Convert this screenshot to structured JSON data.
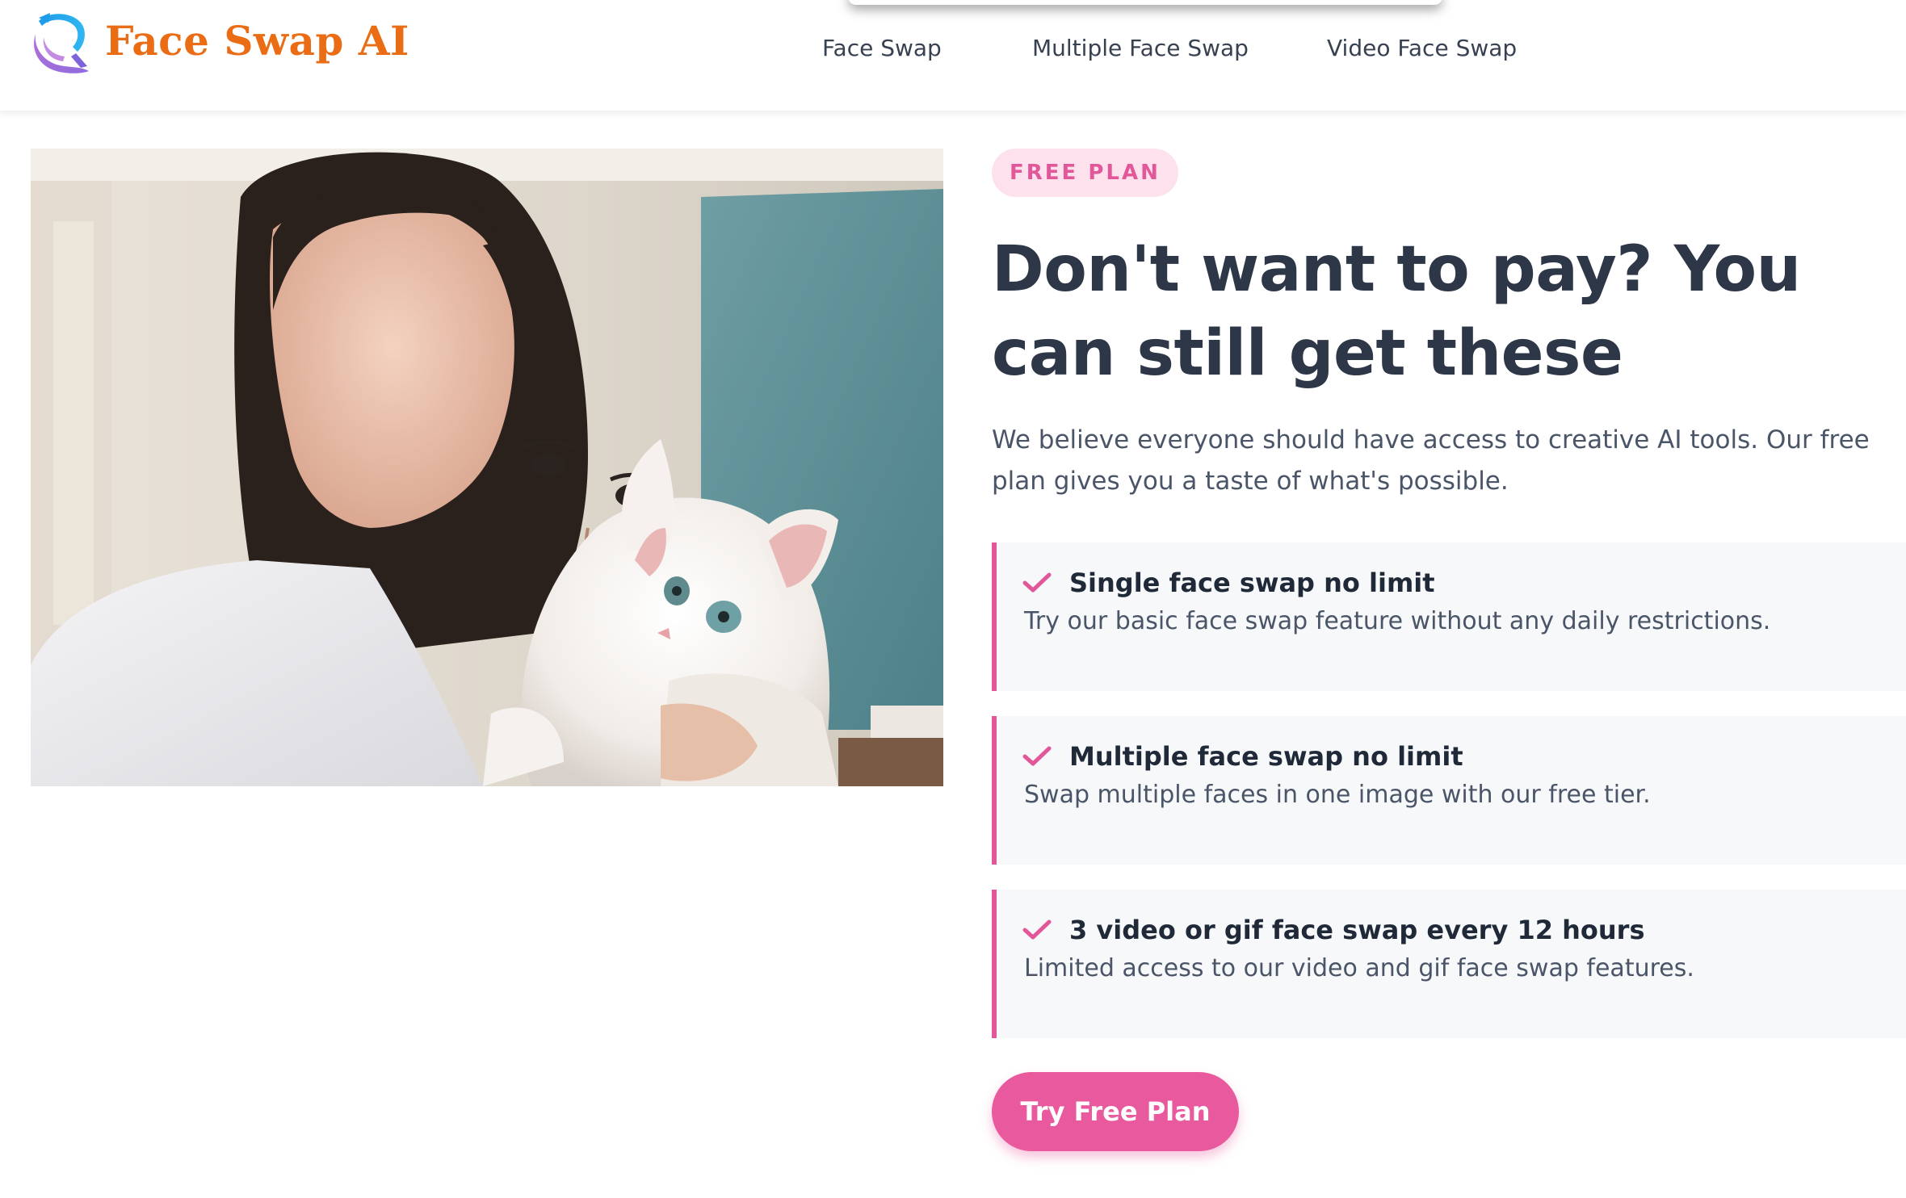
{
  "header": {
    "brand_name": "Face Swap AI",
    "brand_color": "#ea6d16",
    "logo_icon": "swirl-logo-icon",
    "nav": [
      {
        "label": "Face Swap"
      },
      {
        "label": "Multiple Face Swap"
      },
      {
        "label": "Video Face Swap"
      }
    ]
  },
  "hero": {
    "image_subject": "woman-holding-white-cat-photo"
  },
  "content": {
    "badge": "FREE PLAN",
    "headline": "Don't want to pay? You can still get these",
    "intro": "We believe everyone should have access to creative AI tools. Our free plan gives you a taste of what's possible.",
    "features": [
      {
        "title": "Single face swap no limit",
        "description": "Try our basic face swap feature without any daily restrictions.",
        "icon": "check-icon"
      },
      {
        "title": "Multiple face swap no limit",
        "description": "Swap multiple faces in one image with our free tier.",
        "icon": "check-icon"
      },
      {
        "title": "3 video or gif face swap every 12 hours",
        "description": "Limited access to our video and gif face swap features.",
        "icon": "check-icon"
      }
    ],
    "cta_label": "Try Free Plan"
  },
  "colors": {
    "accent": "#e1579a",
    "badge_bg": "#fde2ee",
    "heading": "#2d3748",
    "feature_bg": "#f7f8fa"
  }
}
